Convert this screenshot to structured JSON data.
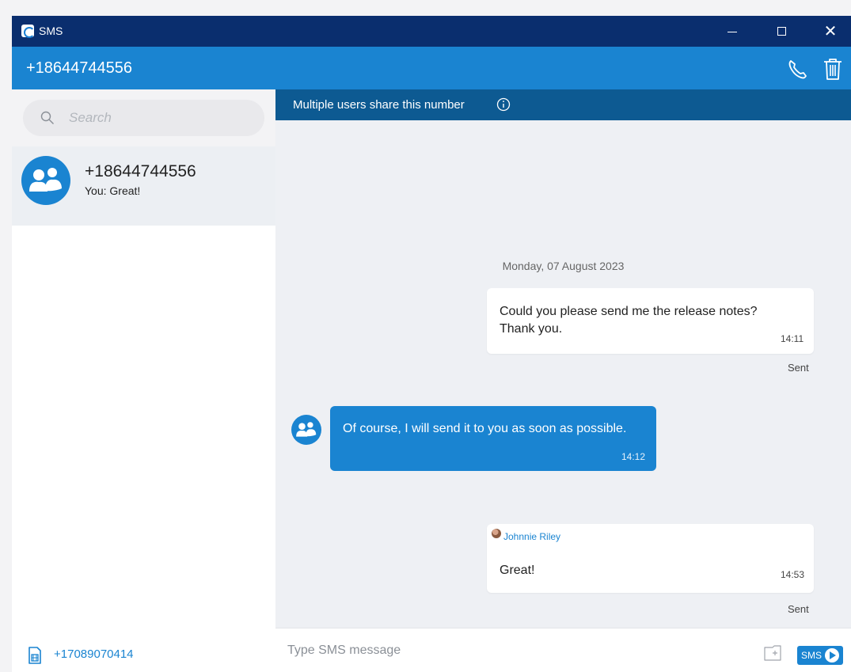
{
  "window": {
    "title": "SMS"
  },
  "header": {
    "contact_number": "+18644744556"
  },
  "banner": {
    "text": "Multiple users share this number"
  },
  "search": {
    "placeholder": "Search"
  },
  "conversations": [
    {
      "number": "+18644744556",
      "preview": "You: Great!"
    }
  ],
  "sidebar": {
    "own_number": "+17089070414"
  },
  "chat": {
    "date_label": "Monday, 07 August 2023",
    "messages": [
      {
        "direction": "outgoing",
        "text": "Could you please send me the release notes? Thank you.",
        "time": "14:11",
        "status": "Sent"
      },
      {
        "direction": "incoming",
        "text": "Of course, I will send it to you as soon as possible.",
        "time": "14:12"
      },
      {
        "direction": "outgoing",
        "sender": "Johnnie Riley",
        "text": "Great!",
        "time": "14:53",
        "status": "Sent"
      }
    ]
  },
  "composer": {
    "placeholder": "Type SMS message",
    "send_label": "SMS"
  },
  "colors": {
    "titlebar": "#0a2e6e",
    "header": "#1a84d1",
    "banner": "#0d5a92",
    "accent": "#1a84d1"
  },
  "icons": [
    "app-logo-icon",
    "minimize-icon",
    "maximize-icon",
    "close-icon",
    "phone-icon",
    "trash-icon",
    "search-icon",
    "group-avatar-icon",
    "info-icon",
    "sim-card-icon",
    "attach-icon",
    "send-arrow-icon"
  ]
}
